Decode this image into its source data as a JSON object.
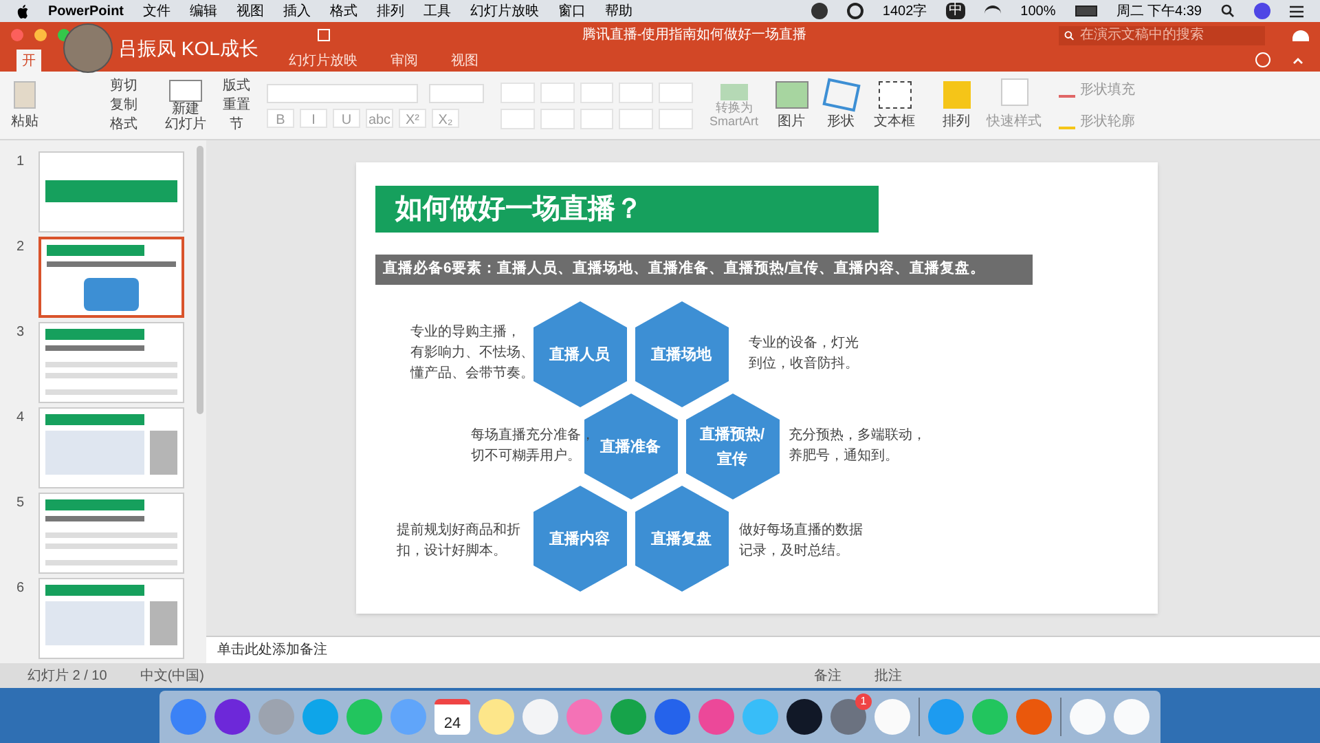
{
  "menu_bar": {
    "app_name": "PowerPoint",
    "items": [
      "文件",
      "编辑",
      "视图",
      "插入",
      "格式",
      "排列",
      "工具",
      "幻灯片放映",
      "窗口",
      "帮助"
    ],
    "word_count": "1402字",
    "input_method": "中",
    "battery": "100%",
    "clock": "周二 下午4:39"
  },
  "title_bar": {
    "title": "腾讯直播-使用指南如何做好一场直播",
    "search_placeholder": "在演示文稿中的搜索"
  },
  "streamer_overlay": {
    "name": "吕振凤 KOL成长"
  },
  "ribbon_tabs": [
    {
      "label": "开",
      "selected": true
    },
    {
      "label": "幻灯片放映",
      "selected": false
    },
    {
      "label": "审阅",
      "selected": false
    },
    {
      "label": "视图",
      "selected": false
    }
  ],
  "ribbon": {
    "paste": "粘贴",
    "cut": "剪切",
    "copy": "复制",
    "format": "格式",
    "new_slide": [
      "新建",
      "幻灯片"
    ],
    "layout": "版式",
    "reset": "重置",
    "section": "节",
    "font_buttons": [
      "B",
      "I",
      "U",
      "abc",
      "X²",
      "X₂"
    ],
    "smartart": [
      "转换为",
      "SmartArt"
    ],
    "insert_buttons": [
      "图片",
      "形状",
      "文本框"
    ],
    "arrange": "排列",
    "quick_styles": "快速样式",
    "shape_fill": "形状填充",
    "shape_outline": "形状轮廓"
  },
  "slides": [
    {
      "number": "1",
      "selected": false,
      "kind": "cover"
    },
    {
      "number": "2",
      "selected": true,
      "kind": "hexagons"
    },
    {
      "number": "3",
      "selected": false,
      "kind": "text"
    },
    {
      "number": "4",
      "selected": false,
      "kind": "photo"
    },
    {
      "number": "5",
      "selected": false,
      "kind": "text"
    },
    {
      "number": "6",
      "selected": false,
      "kind": "photo"
    }
  ],
  "slide": {
    "title": "如何做好一场直播？",
    "subtitle": "直播必备6要素：直播人员、直播场地、直播准备、直播预热/宣传、直播内容、直播复盘。",
    "elements": [
      {
        "label": "直播人员",
        "description": [
          "专业的导购主播，",
          "有影响力、不怯场、",
          "懂产品、会带节奏。"
        ]
      },
      {
        "label": "直播场地",
        "description": [
          "专业的设备，灯光",
          "到位，收音防抖。"
        ]
      },
      {
        "label": "直播准备",
        "description": [
          "每场直播充分准备，",
          "切不可糊弄用户。"
        ]
      },
      {
        "label": "直播预热/宣传",
        "description": [
          "充分预热，多端联动，",
          "养肥号，通知到。"
        ]
      },
      {
        "label": "直播内容",
        "description": [
          "提前规划好商品和折",
          "扣，设计好脚本。"
        ]
      },
      {
        "label": "直播复盘",
        "description": [
          "做好每场直播的数据",
          "记录，及时总结。"
        ]
      }
    ]
  },
  "notes_placeholder": "单击此处添加备注",
  "status_bar": {
    "slide_counter": "幻灯片 2 / 10",
    "language": "中文(中国)",
    "notes": "备注",
    "comments": "批注"
  },
  "dock": [
    {
      "kind": "app",
      "color": "#3b82f6"
    },
    {
      "kind": "app",
      "color": "#6d28d9"
    },
    {
      "kind": "app",
      "color": "#9ca3af"
    },
    {
      "kind": "app",
      "color": "#0ea5e9"
    },
    {
      "kind": "app",
      "color": "#22c55e"
    },
    {
      "kind": "app",
      "color": "#60a5fa"
    },
    {
      "kind": "calendar",
      "color": "#ffffff",
      "text": "24"
    },
    {
      "kind": "app",
      "color": "#fde68a"
    },
    {
      "kind": "app",
      "color": "#f3f4f6"
    },
    {
      "kind": "app",
      "color": "#f472b6"
    },
    {
      "kind": "app",
      "color": "#16a34a"
    },
    {
      "kind": "app",
      "color": "#2563eb"
    },
    {
      "kind": "app",
      "color": "#ec4899"
    },
    {
      "kind": "app",
      "color": "#38bdf8"
    },
    {
      "kind": "app",
      "color": "#111827"
    },
    {
      "kind": "app",
      "color": "#6b7280",
      "badge": "1"
    },
    {
      "kind": "app",
      "color": "#fafafa"
    },
    {
      "kind": "divider"
    },
    {
      "kind": "app",
      "color": "#1d9bf0"
    },
    {
      "kind": "app",
      "color": "#22c55e"
    },
    {
      "kind": "app",
      "color": "#ea580c"
    },
    {
      "kind": "divider"
    },
    {
      "kind": "app",
      "color": "#f9fafb"
    },
    {
      "kind": "app",
      "color": "#f9fafb"
    }
  ]
}
